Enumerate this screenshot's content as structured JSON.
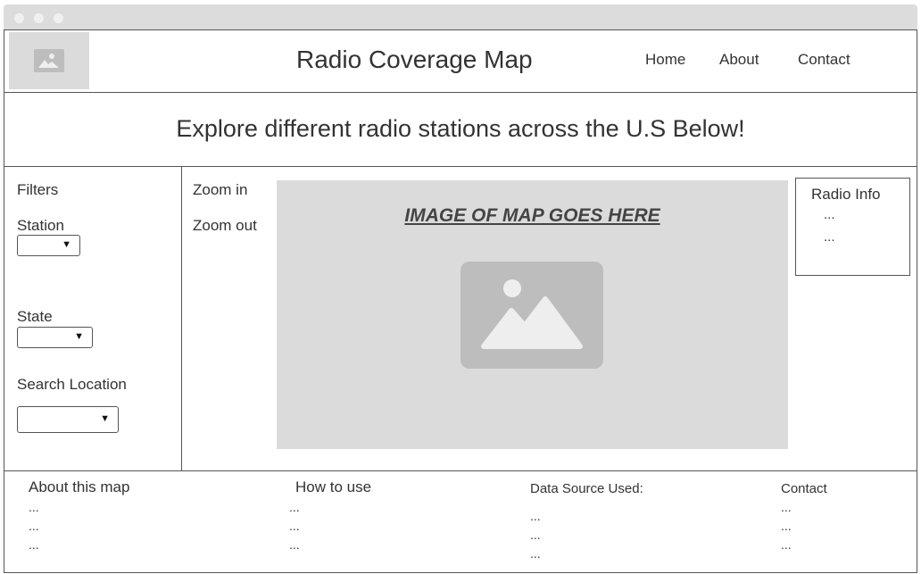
{
  "header": {
    "logo_icon": "image-placeholder-icon",
    "title": "Radio Coverage Map",
    "nav": {
      "home": "Home",
      "about": "About",
      "contact": "Contact"
    }
  },
  "banner": {
    "text": "Explore different radio stations across the U.S Below!"
  },
  "sidebar": {
    "filters_label": "Filters",
    "station_label": "Station",
    "state_label": "State",
    "search_location_label": "Search Location"
  },
  "map": {
    "zoom_in": "Zoom in",
    "zoom_out": "Zoom out",
    "caption": "IMAGE OF MAP GOES HERE",
    "image_icon": "image-placeholder-icon"
  },
  "radio_info": {
    "title": "Radio Info",
    "lines": [
      "...",
      "..."
    ]
  },
  "footer": {
    "about": {
      "title": "About this map",
      "lines": [
        "...",
        "...",
        "..."
      ]
    },
    "how_to_use": {
      "title": "How to use",
      "lines": [
        "...",
        "...",
        "..."
      ]
    },
    "data_source": {
      "title": "Data Source Used:",
      "lines": [
        "...",
        "...",
        "..."
      ]
    },
    "contact": {
      "title": "Contact",
      "lines": [
        "...",
        "...",
        "..."
      ]
    }
  },
  "colors": {
    "placeholder": "#dbdbdb",
    "placeholder_dark": "#bdbdbd",
    "border": "#555555",
    "text": "#333333"
  }
}
